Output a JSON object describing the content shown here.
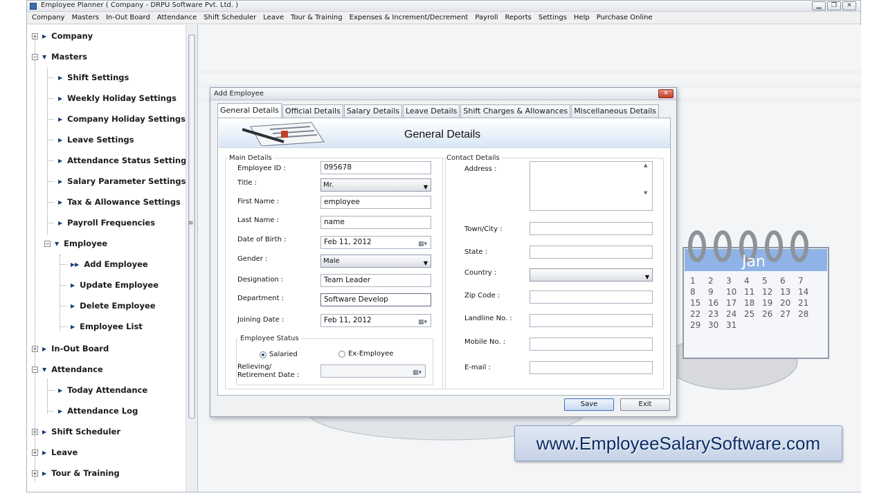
{
  "window": {
    "title": "Employee Planner ( Company - DRPU Software Pvt. Ltd. )"
  },
  "menu": [
    "Company",
    "Masters",
    "In-Out Board",
    "Attendance",
    "Shift Scheduler",
    "Leave",
    "Tour & Training",
    "Expenses & Increment/Decrement",
    "Payroll",
    "Reports",
    "Settings",
    "Help",
    "Purchase Online"
  ],
  "tree": [
    {
      "label": "Company",
      "icon": "plus-box"
    },
    {
      "label": "Masters",
      "icon": "minus-box"
    },
    {
      "label": "Shift Settings"
    },
    {
      "label": "Weekly Holiday Settings"
    },
    {
      "label": "Company Holiday Settings"
    },
    {
      "label": "Leave Settings"
    },
    {
      "label": "Attendance Status Settings"
    },
    {
      "label": "Salary Parameter Settings"
    },
    {
      "label": "Tax & Allowance Settings"
    },
    {
      "label": "Payroll Frequencies"
    },
    {
      "label": "Employee",
      "icon": "minus-box"
    },
    {
      "label": "Add Employee",
      "selected": true
    },
    {
      "label": "Update Employee"
    },
    {
      "label": "Delete Employee"
    },
    {
      "label": "Employee List"
    },
    {
      "label": "In-Out Board",
      "icon": "plus-box"
    },
    {
      "label": "Attendance",
      "icon": "minus-box"
    },
    {
      "label": "Today Attendance"
    },
    {
      "label": "Attendance Log"
    },
    {
      "label": "Shift Scheduler",
      "icon": "plus-box"
    },
    {
      "label": "Leave",
      "icon": "plus-box"
    },
    {
      "label": "Tour & Training",
      "icon": "plus-box"
    }
  ],
  "dialog": {
    "title": "Add Employee",
    "tabs": [
      "General Details",
      "Official Details",
      "Salary Details",
      "Leave Details",
      "Shift Charges & Allowances",
      "Miscellaneous Details"
    ],
    "heading": "General Details",
    "main_section": "Main Details",
    "contact_section": "Contact Details",
    "status_section": "Employee Status",
    "labels": {
      "employee_id": "Employee ID :",
      "title": "Title :",
      "first_name": "First Name :",
      "last_name": "Last Name :",
      "dob": "Date of Birth :",
      "gender": "Gender :",
      "designation": "Designation :",
      "department": "Department :",
      "joining_date": "Joining Date :",
      "relieving_1": "Relieving/",
      "relieving_2": "Retirement Date :",
      "address": "Address :",
      "town": "Town/City :",
      "state": "State :",
      "country": "Country :",
      "zip": "Zip Code :",
      "landline": "Landline No. :",
      "mobile": "Mobile No. :",
      "email": "E-mail :"
    },
    "values": {
      "employee_id": "095678",
      "title": "Mr.",
      "first_name": "employee",
      "last_name": "name",
      "dob": "Feb 11, 2012",
      "gender": "Male",
      "designation": "Team Leader",
      "department": "Software Develop",
      "joining_date": "Feb 11, 2012"
    },
    "status": {
      "salaried": "Salaried",
      "ex_employee": "Ex-Employee",
      "selected": "Salaried"
    },
    "buttons": {
      "save": "Save",
      "exit": "Exit"
    }
  },
  "background": {
    "calendar_month": "Jan",
    "calendar_days": [
      "1",
      "2",
      "3",
      "4",
      "5",
      "6",
      "7",
      "8",
      "9",
      "10",
      "11",
      "12",
      "13",
      "14",
      "15",
      "16",
      "17",
      "18",
      "19",
      "20",
      "21",
      "22",
      "23",
      "24",
      "25",
      "26",
      "27",
      "28",
      "29",
      "30",
      "31"
    ],
    "website": "www.EmployeeSalarySoftware.com"
  }
}
